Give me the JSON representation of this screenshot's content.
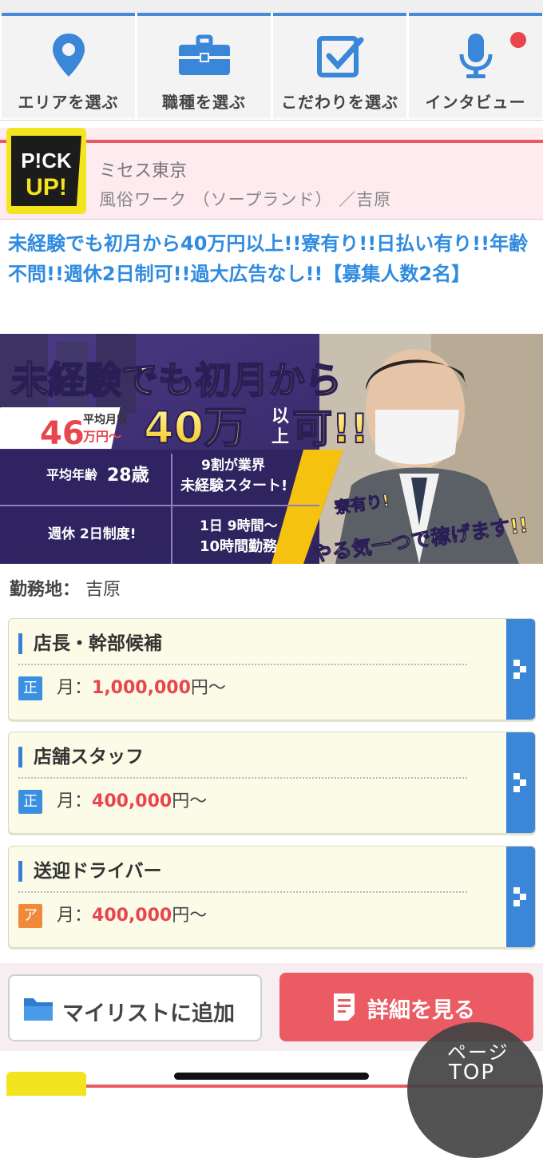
{
  "nav": {
    "items": [
      {
        "label": "エリアを選ぶ",
        "icon": "location-pin-icon"
      },
      {
        "label": "職種を選ぶ",
        "icon": "briefcase-icon"
      },
      {
        "label": "こだわりを選ぶ",
        "icon": "checkbox-icon"
      },
      {
        "label": "インタビュー",
        "icon": "microphone-icon"
      }
    ],
    "accent_color": "#4a89d6",
    "notification_color": "#e8454e"
  },
  "shop": {
    "pickup_badge": [
      "P!CK",
      "UP!"
    ],
    "name": "ミセス東京",
    "category": "風俗ワーク （ソープランド） ／吉原"
  },
  "headline": "未経験でも初月から40万円以上!!寮有り!!日払い有り!!年齢不問!!週休2日制可!!過大広告なし!!【募集人数2名】",
  "banner": {
    "title": "未経験でも初月から",
    "avg_label": "平均月収",
    "avg_amount": "46",
    "avg_unit": "万円～",
    "amount": "40万",
    "amount_suffix_top": "以",
    "amount_suffix_bottom": "上",
    "amount_end": "可!!",
    "age_prefix": "平均年齢",
    "age_value": "28歳",
    "percent_line1": "9割が業界",
    "percent_line2": "未経験スタート!",
    "holiday": "週休 2日制度!",
    "hours_line1": "1日 9時間～",
    "hours_line2": "10時間勤務",
    "dorm": "寮有り!",
    "slogan": "やる気一つで稼げます!!"
  },
  "location": {
    "label": "勤務地：",
    "value": "吉原"
  },
  "jobs": [
    {
      "title": "店長・幹部候補",
      "type": "正",
      "salary_prefix": "月：",
      "amount": "1,000,000",
      "unit": "円〜"
    },
    {
      "title": "店舗スタッフ",
      "type": "正",
      "salary_prefix": "月：",
      "amount": "400,000",
      "unit": "円〜"
    },
    {
      "title": "送迎ドライバー",
      "type": "ア",
      "salary_prefix": "月：",
      "amount": "400,000",
      "unit": "円〜"
    }
  ],
  "actions": {
    "mylist_label": "マイリストに追加",
    "detail_label": "詳細を見る",
    "detail_color": "#ea5b64"
  },
  "page_top": {
    "line1": "ページ",
    "line2": "TOP"
  }
}
